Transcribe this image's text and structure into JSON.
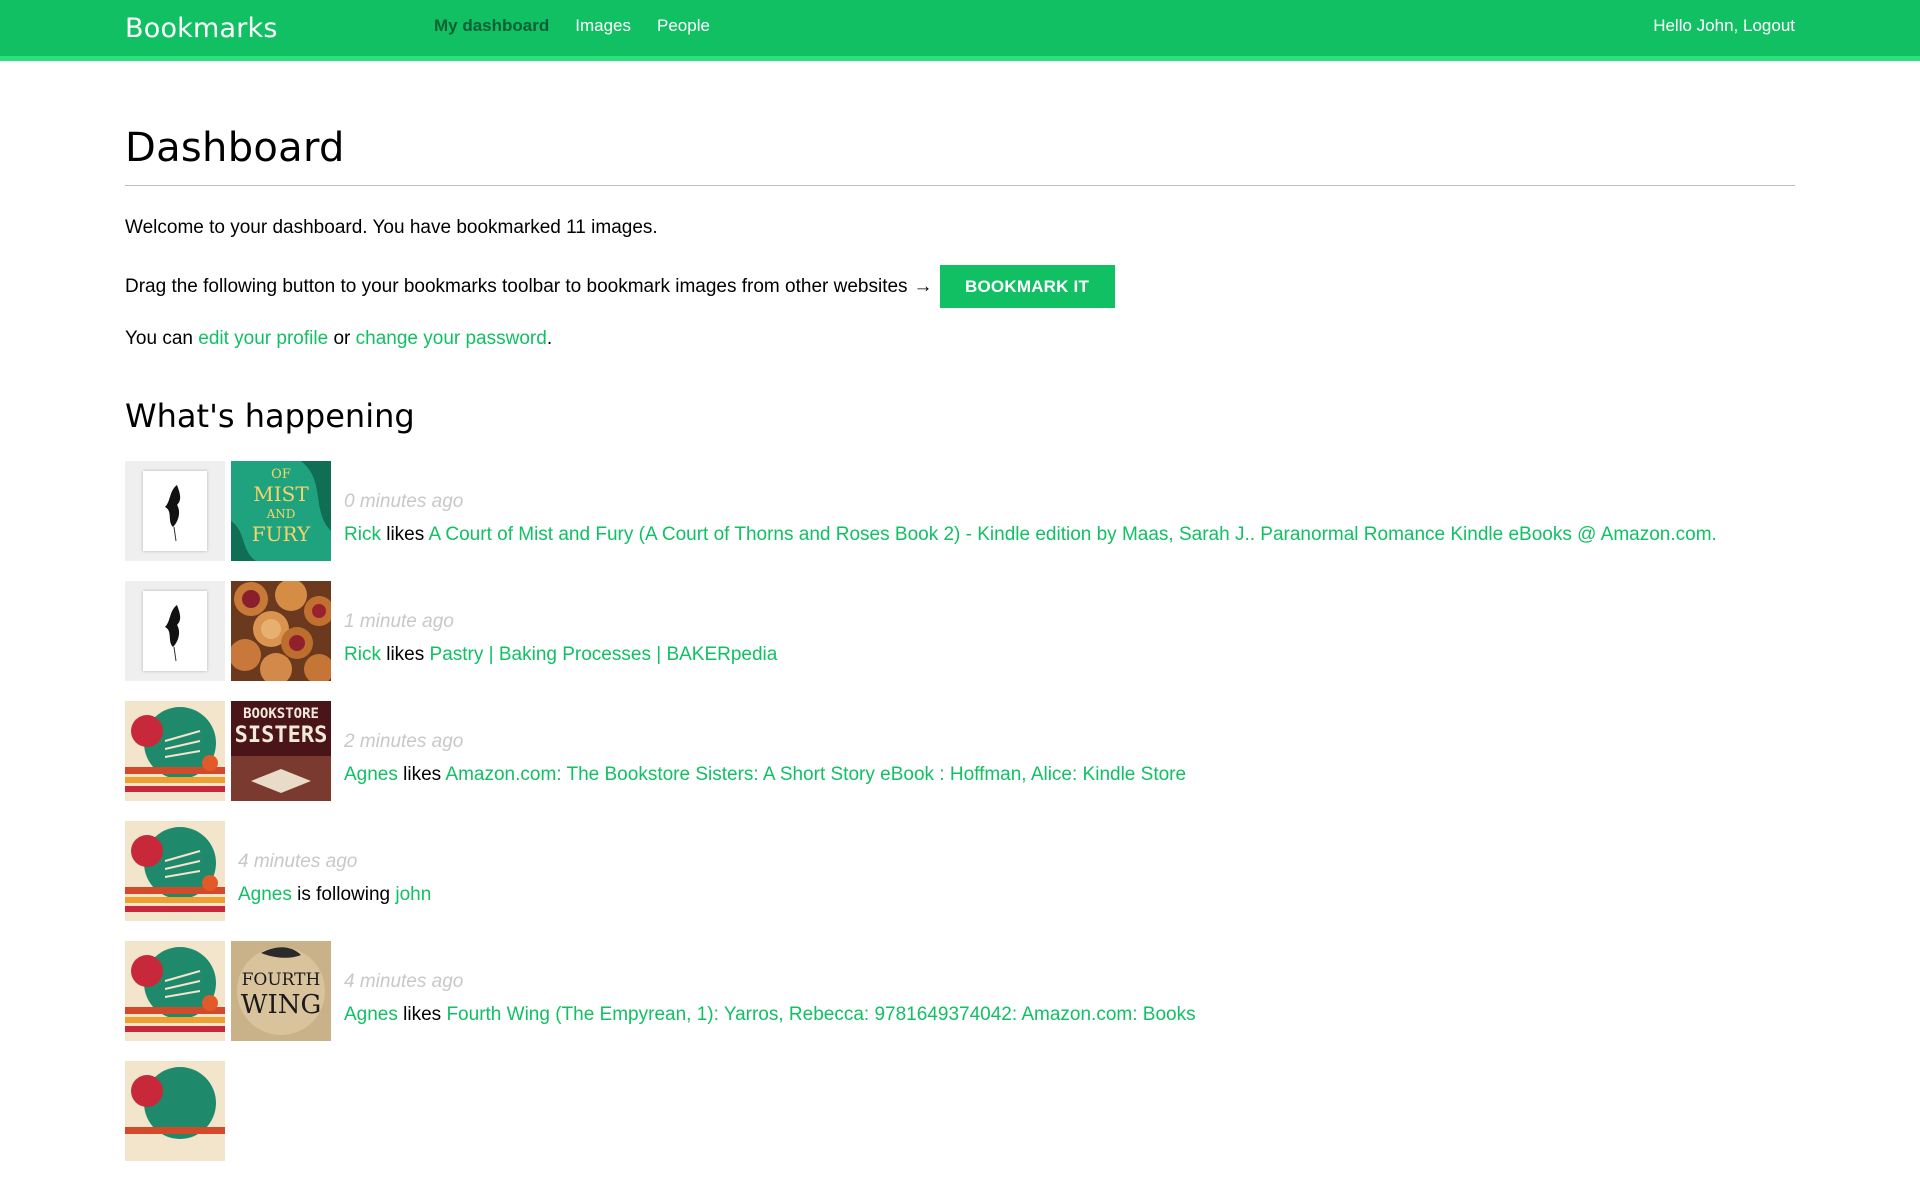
{
  "header": {
    "logo": "Bookmarks",
    "nav": [
      {
        "label": "My dashboard",
        "active": true
      },
      {
        "label": "Images",
        "active": false
      },
      {
        "label": "People",
        "active": false
      }
    ],
    "greeting": "Hello John,",
    "logout": "Logout"
  },
  "page": {
    "title": "Dashboard",
    "welcome": "Welcome to your dashboard. You have bookmarked 11 images.",
    "drag_text": "Drag the following button to your bookmarks toolbar to bookmark images from other websites",
    "arrow": "→",
    "bookmark_button": "BOOKMARK IT",
    "profile_prefix": "You can",
    "edit_profile": "edit your profile",
    "or": "or",
    "change_password": "change your password",
    "period": ".",
    "happening_title": "What's happening"
  },
  "colors": {
    "brand": "#12c064",
    "brand_light": "#2de27d",
    "active_nav": "#0b6135",
    "timestamp": "#c8c8c8"
  },
  "actions": [
    {
      "time": "0 minutes ago",
      "user": "Rick",
      "verb": "likes",
      "target": "A Court of Mist and Fury (A Court of Thorns and Roses Book 2) - Kindle edition by Maas, Sarah J.. Paranormal Romance Kindle eBooks @ Amazon.com.",
      "user_avatar": "framed-sketch-avatar",
      "target_image": "book-cover-mist-and-fury",
      "target_image_text": [
        "OF",
        "MIST",
        "AND",
        "FURY"
      ]
    },
    {
      "time": "1 minute ago",
      "user": "Rick",
      "verb": "likes",
      "target": "Pastry | Baking Processes | BAKERpedia",
      "user_avatar": "framed-sketch-avatar",
      "target_image": "pastry-photo"
    },
    {
      "time": "2 minutes ago",
      "user": "Agnes",
      "verb": "likes",
      "target": "Amazon.com: The Bookstore Sisters: A Short Story eBook : Hoffman, Alice: Kindle Store",
      "user_avatar": "retro-poster-avatar",
      "target_image": "book-cover-bookstore-sisters",
      "target_image_text": [
        "BOOKSTORE",
        "SISTERS"
      ]
    },
    {
      "time": "4 minutes ago",
      "user": "Agnes",
      "verb": "is following",
      "target": "john",
      "user_avatar": "retro-poster-avatar"
    },
    {
      "time": "4 minutes ago",
      "user": "Agnes",
      "verb": "likes",
      "target": "Fourth Wing (The Empyrean, 1): Yarros, Rebecca: 9781649374042: Amazon.com: Books",
      "user_avatar": "retro-poster-avatar",
      "target_image": "book-cover-fourth-wing",
      "target_image_text": [
        "FOURTH",
        "WING"
      ]
    }
  ]
}
